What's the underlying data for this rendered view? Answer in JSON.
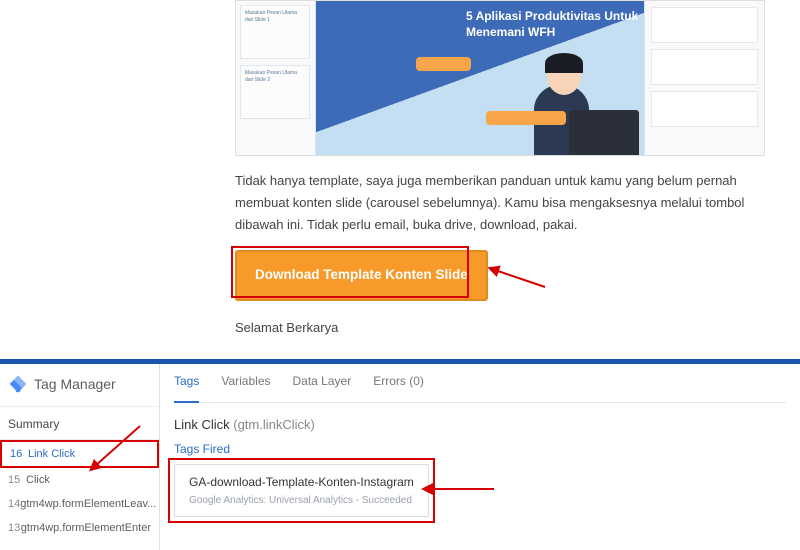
{
  "slide": {
    "title": "5 Aplikasi Produktivitas Untuk Menemani WFH",
    "thumb1": "Masukan Pesan Utama dari Slide 1",
    "thumb2": "Masukan Pesan Utama dari Slide 2"
  },
  "article": {
    "paragraph": "Tidak hanya template, saya juga memberikan panduan untuk kamu yang belum pernah membuat konten slide (carousel sebelumnya). Kamu bisa mengaksesnya melalui tombol dibawah ini. Tidak perlu email, buka drive, download, pakai.",
    "button": "Download Template Konten Slide",
    "closing": "Selamat Berkarya"
  },
  "gtm": {
    "brand": "Tag Manager",
    "summary": "Summary",
    "tabs": {
      "tags": "Tags",
      "variables": "Variables",
      "dataLayer": "Data Layer",
      "errors": "Errors (0)"
    },
    "events": [
      {
        "num": "16",
        "label": "Link Click"
      },
      {
        "num": "15",
        "label": "Click"
      },
      {
        "num": "14",
        "label": "gtm4wp.formElementLeav..."
      },
      {
        "num": "13",
        "label": "gtm4wp.formElementEnter"
      }
    ],
    "detail": {
      "title": "Link Click",
      "titleSub": "(gtm.linkClick)",
      "tagsFired": "Tags Fired",
      "tagName": "GA-download-Template-Konten-Instagram",
      "tagSub": "Google Analytics: Universal Analytics - Succeeded"
    }
  }
}
